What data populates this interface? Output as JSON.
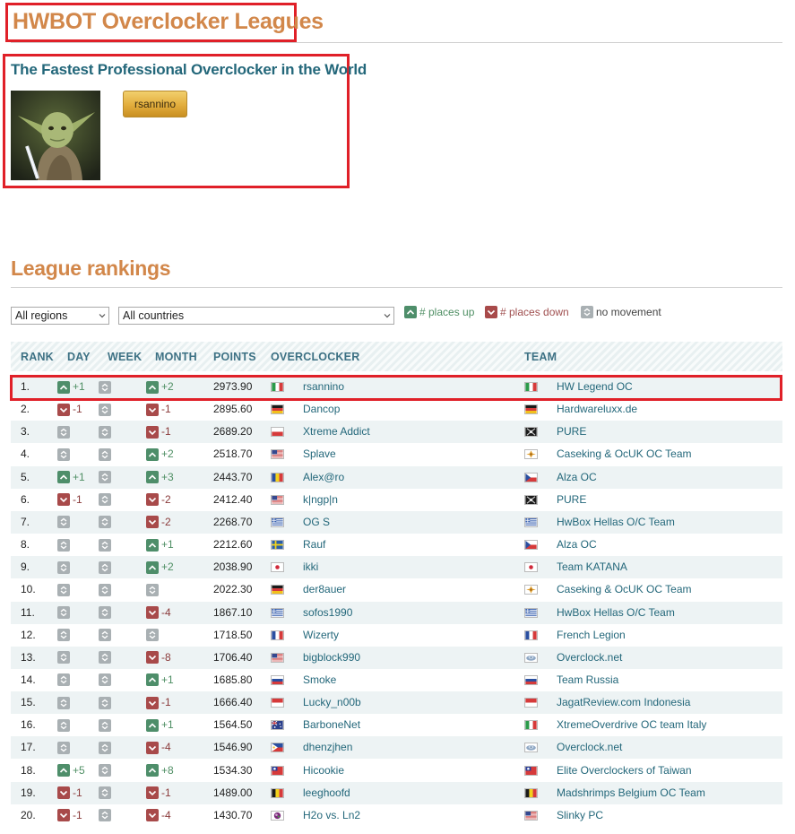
{
  "header": {
    "site_title": "HWBOT Overclocker Leagues"
  },
  "pro": {
    "title": "The Fastest Professional Overclocker in the World",
    "leader_button": "rsannino"
  },
  "rankings": {
    "title": "League rankings",
    "region_select": "All regions",
    "country_select": "All countries",
    "legend": {
      "up": "# places up",
      "down": "# places down",
      "none": "no movement"
    },
    "columns": {
      "rank": "RANK",
      "day": "DAY",
      "week": "WEEK",
      "month": "MONTH",
      "points": "POINTS",
      "overclocker": "OVERCLOCKER",
      "team": "TEAM"
    },
    "rows": [
      {
        "rank": "1.",
        "day": "+1",
        "week": "",
        "month": "+2",
        "points": "2973.90",
        "overclocker": "rsannino",
        "oc_flag": "italy",
        "team": "HW Legend OC",
        "team_flag": "italy"
      },
      {
        "rank": "2.",
        "day": "-1",
        "week": "",
        "month": "-1",
        "points": "2895.60",
        "overclocker": "Dancop",
        "oc_flag": "germany",
        "team": "Hardwareluxx.de",
        "team_flag": "germany"
      },
      {
        "rank": "3.",
        "day": "",
        "week": "",
        "month": "-1",
        "points": "2689.20",
        "overclocker": "Xtreme Addict",
        "oc_flag": "poland",
        "team": "PURE",
        "team_flag": "pure"
      },
      {
        "rank": "4.",
        "day": "",
        "week": "",
        "month": "+2",
        "points": "2518.70",
        "overclocker": "Splave",
        "oc_flag": "usa",
        "team": "Caseking & OcUK OC Team",
        "team_flag": "caseking"
      },
      {
        "rank": "5.",
        "day": "+1",
        "week": "",
        "month": "+3",
        "points": "2443.70",
        "overclocker": "Alex@ro",
        "oc_flag": "romania",
        "team": "Alza OC",
        "team_flag": "czech"
      },
      {
        "rank": "6.",
        "day": "-1",
        "week": "",
        "month": "-2",
        "points": "2412.40",
        "overclocker": "k|ngp|n",
        "oc_flag": "usa",
        "team": "PURE",
        "team_flag": "pure"
      },
      {
        "rank": "7.",
        "day": "",
        "week": "",
        "month": "-2",
        "points": "2268.70",
        "overclocker": "OG S",
        "oc_flag": "greece",
        "team": "HwBox Hellas O/C Team",
        "team_flag": "greece"
      },
      {
        "rank": "8.",
        "day": "",
        "week": "",
        "month": "+1",
        "points": "2212.60",
        "overclocker": "Rauf",
        "oc_flag": "sweden",
        "team": "Alza OC",
        "team_flag": "czech"
      },
      {
        "rank": "9.",
        "day": "",
        "week": "",
        "month": "+2",
        "points": "2038.90",
        "overclocker": "ikki",
        "oc_flag": "japan",
        "team": "Team KATANA",
        "team_flag": "japan"
      },
      {
        "rank": "10.",
        "day": "",
        "week": "",
        "month": "",
        "points": "2022.30",
        "overclocker": "der8auer",
        "oc_flag": "germany",
        "team": "Caseking & OcUK OC Team",
        "team_flag": "caseking"
      },
      {
        "rank": "11.",
        "day": "",
        "week": "",
        "month": "-4",
        "points": "1867.10",
        "overclocker": "sofos1990",
        "oc_flag": "greece",
        "team": "HwBox Hellas O/C Team",
        "team_flag": "greece"
      },
      {
        "rank": "12.",
        "day": "",
        "week": "",
        "month": "",
        "points": "1718.50",
        "overclocker": "Wizerty",
        "oc_flag": "france",
        "team": "French Legion",
        "team_flag": "france"
      },
      {
        "rank": "13.",
        "day": "",
        "week": "",
        "month": "-8",
        "points": "1706.40",
        "overclocker": "bigblock990",
        "oc_flag": "usa",
        "team": "Overclock.net",
        "team_flag": "ocn"
      },
      {
        "rank": "14.",
        "day": "",
        "week": "",
        "month": "+1",
        "points": "1685.80",
        "overclocker": "Smoke",
        "oc_flag": "russia",
        "team": "Team Russia",
        "team_flag": "russia"
      },
      {
        "rank": "15.",
        "day": "",
        "week": "",
        "month": "-1",
        "points": "1666.40",
        "overclocker": "Lucky_n00b",
        "oc_flag": "indonesia",
        "team": "JagatReview.com Indonesia",
        "team_flag": "indonesia"
      },
      {
        "rank": "16.",
        "day": "",
        "week": "",
        "month": "+1",
        "points": "1564.50",
        "overclocker": "BarboneNet",
        "oc_flag": "australia",
        "team": "XtremeOverdrive OC team Italy",
        "team_flag": "italy"
      },
      {
        "rank": "17.",
        "day": "",
        "week": "",
        "month": "-4",
        "points": "1546.90",
        "overclocker": "dhenzjhen",
        "oc_flag": "philippines",
        "team": "Overclock.net",
        "team_flag": "ocn"
      },
      {
        "rank": "18.",
        "day": "+5",
        "week": "",
        "month": "+8",
        "points": "1534.30",
        "overclocker": "Hicookie",
        "oc_flag": "taiwan",
        "team": "Elite Overclockers of Taiwan",
        "team_flag": "taiwan"
      },
      {
        "rank": "19.",
        "day": "-1",
        "week": "",
        "month": "-1",
        "points": "1489.00",
        "overclocker": "leeghoofd",
        "oc_flag": "belgium",
        "team": "Madshrimps Belgium OC Team",
        "team_flag": "belgium"
      },
      {
        "rank": "20.",
        "day": "-1",
        "week": "",
        "month": "-4",
        "points": "1430.70",
        "overclocker": "H2o vs. Ln2",
        "oc_flag": "h2o",
        "team": "Slinky PC",
        "team_flag": "usa"
      }
    ]
  }
}
